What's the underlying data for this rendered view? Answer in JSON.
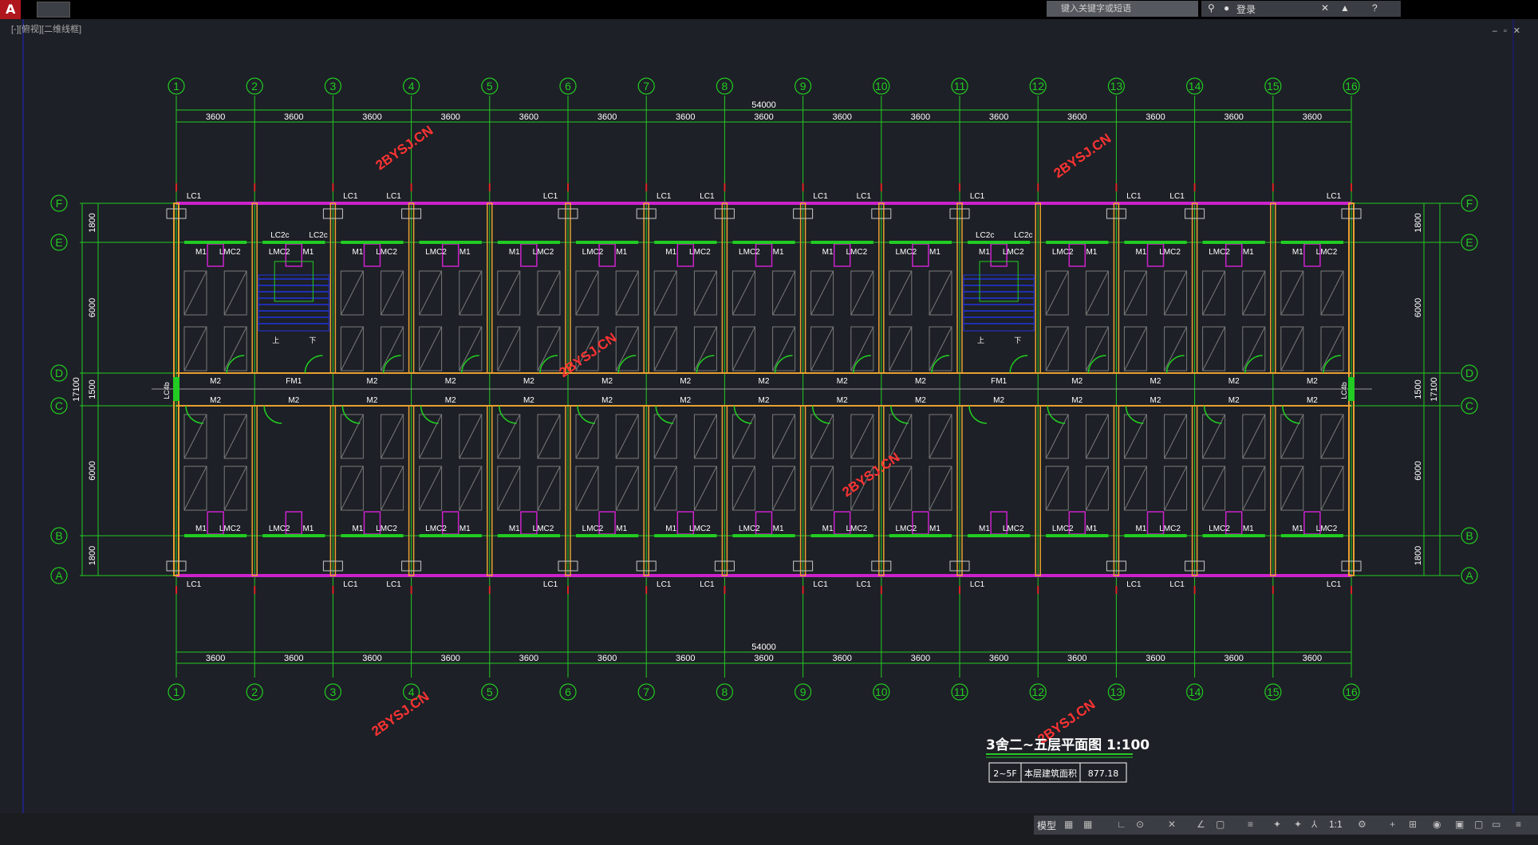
{
  "app": {
    "search_placeholder": "键入关键字或短语",
    "login_label": "登录",
    "view_label": "[-][俯视][二维线框]",
    "model_tab": "模型",
    "scale": "1:1"
  },
  "drawing": {
    "columns": [
      "1",
      "2",
      "3",
      "4",
      "5",
      "6",
      "7",
      "8",
      "9",
      "10",
      "11",
      "12",
      "13",
      "14",
      "15",
      "16"
    ],
    "rows": [
      "F",
      "E",
      "D",
      "C",
      "B",
      "A"
    ],
    "bay_dim": "3600",
    "total_dim": "54000",
    "vertical_dims": {
      "top": "1800",
      "upper_room": "6000",
      "corridor": "1500",
      "lower_room": "6000",
      "bottom": "1800",
      "total": "17100"
    },
    "labels": {
      "window_lc1": "LC1",
      "window_lc2c": "LC2c",
      "window_lc4b": "LC4b",
      "door_m1": "M1",
      "door_m2": "M2",
      "door_fm1": "FM1",
      "door_lmc2": "LMC2",
      "stair_up": "上",
      "stair_down": "下"
    },
    "watermark": "2BYSJ.CN",
    "title": "3舍二~五层平面图  1:100",
    "info_table": [
      "2~5F",
      "本层建筑面积",
      "877.18"
    ]
  },
  "colors": {
    "axis": "#22cc22",
    "wall": "#e8a030",
    "magenta": "#cc22cc",
    "red": "#dd2222",
    "blue": "#2233dd",
    "watermark": "#ff3333",
    "background": "#1d2026"
  }
}
